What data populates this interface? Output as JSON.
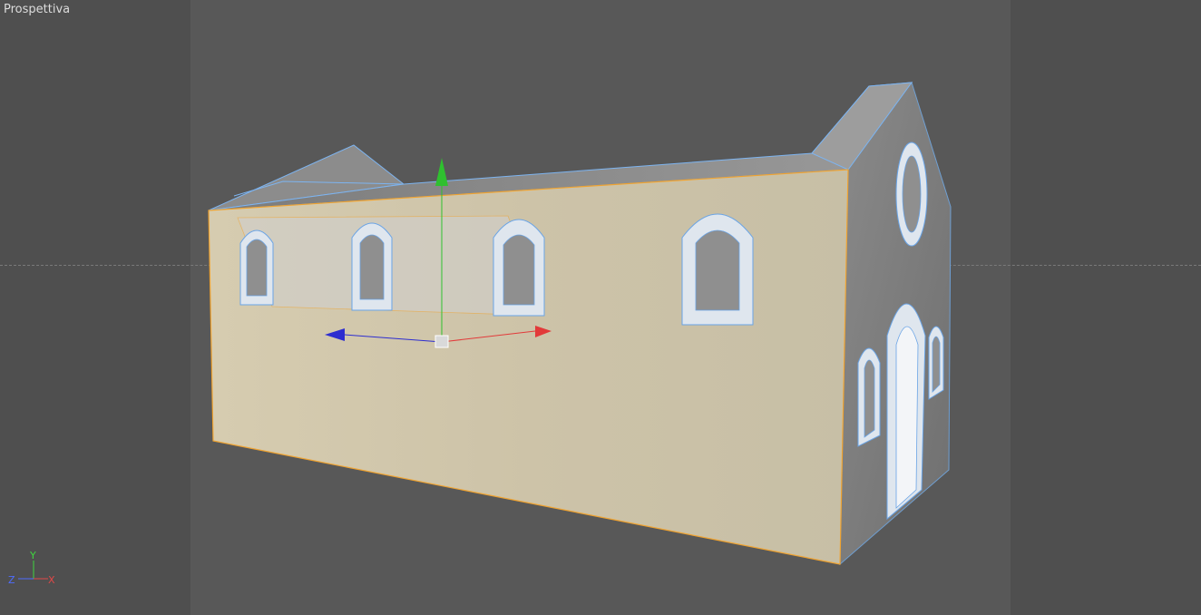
{
  "viewport": {
    "camera_label": "Prospettiva"
  },
  "axis_indicator": {
    "y_label": "Y",
    "z_label": "Z",
    "x_label": "X",
    "y_color": "#3fd63f",
    "z_color": "#4f6cff",
    "x_color": "#e04848"
  },
  "object": {
    "name": "church-building",
    "selected_face_color": "#cdc3a8",
    "selection_edge_color": "#f0a330",
    "wire_color": "#7db4f0"
  },
  "gizmo": {
    "y_color": "#2fc02f",
    "x_color": "#e23a3a",
    "z_color": "#2d2dd0"
  }
}
